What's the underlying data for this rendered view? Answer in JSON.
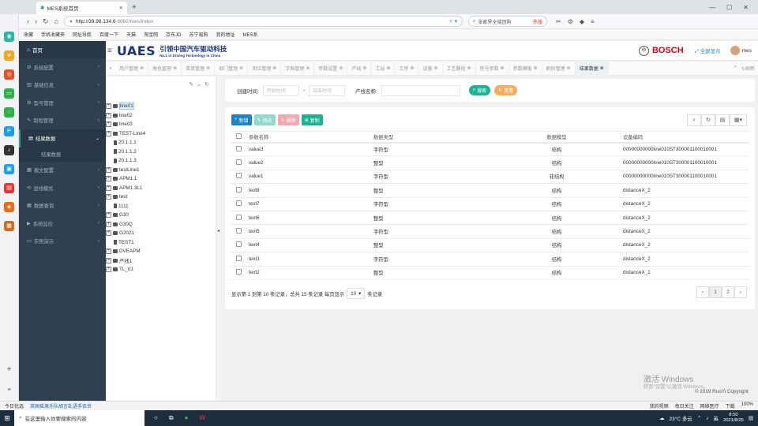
{
  "browser": {
    "tab_title": "MES系统首页",
    "url_host": "http://39.98.134.6",
    "url_path": ":8082/mes/index",
    "search_text": "张家界全域团购",
    "search_hot": "热搜",
    "favorites": [
      "收藏",
      "手机收藏夹",
      "网址导航",
      "百度一下",
      "天猫",
      "淘宝网",
      "京东JD",
      "苏宁易购",
      "我的地址",
      "MES系"
    ]
  },
  "sidebar": {
    "home": "首页",
    "items": [
      {
        "label": "系统配置"
      },
      {
        "label": "基础信息"
      },
      {
        "label": "型号管理"
      },
      {
        "label": "制程管理"
      },
      {
        "label": "结果数据"
      },
      {
        "label": "报文配置"
      },
      {
        "label": "混线模式"
      },
      {
        "label": "数据查询"
      },
      {
        "label": "系统监控"
      },
      {
        "label": "实例演示"
      }
    ],
    "sub_item": "结果数据"
  },
  "header": {
    "logo": "UAES",
    "company_cn": "引领中国汽车驱动科技",
    "company_en": "No.1 in Driving Technology in China",
    "bosch": "BOSCH",
    "fullscreen": "全屏显示",
    "user": "mes"
  },
  "page_tabs": [
    "用户管理",
    "角色管理",
    "菜单管理",
    "部门管理",
    "岗位管理",
    "字典管理",
    "参数设置",
    "产线",
    "工站",
    "工序",
    "设备",
    "工艺路径",
    "型号参数",
    "参数模板",
    "刷码管理",
    "结果数据"
  ],
  "refresh_label": "刷新",
  "tree": {
    "nodes": [
      {
        "label": "line01"
      },
      {
        "label": "line02"
      },
      {
        "label": "line03"
      },
      {
        "label": "TEST-Line4"
      },
      {
        "label": "20.1.1.1"
      },
      {
        "label": "20.1.1.2"
      },
      {
        "label": "20.1.1.3"
      },
      {
        "label": "testLine1"
      },
      {
        "label": "APM1.1"
      },
      {
        "label": "APM1.3L1"
      },
      {
        "label": "test"
      },
      {
        "label": "1111"
      },
      {
        "label": "G30"
      },
      {
        "label": "G30Q"
      },
      {
        "label": "G2021"
      },
      {
        "label": "TEST1"
      },
      {
        "label": "DVEAPM"
      },
      {
        "label": "产线1"
      },
      {
        "label": "TL_01"
      }
    ]
  },
  "search": {
    "time_label": "创建时间:",
    "start_placeholder": "开始时间",
    "end_placeholder": "结束时间",
    "line_label": "产线名称:",
    "search_btn": "搜索",
    "reset_btn": "重置"
  },
  "toolbar": {
    "add": "新增",
    "edit": "修改",
    "delete": "删除",
    "copy": "复制"
  },
  "table": {
    "headers": [
      "参数名称",
      "数据类型",
      "数据模型",
      "设备编码"
    ],
    "rows": [
      [
        "value3",
        "字符型",
        "结构",
        "00000000000line010ST300001100010001"
      ],
      [
        "value2",
        "整型",
        "结构",
        "00000000000line010ST300001100010001"
      ],
      [
        "value1",
        "字符型",
        "非结构",
        "00000000000line010ST300001100010001"
      ],
      [
        "text8",
        "整型",
        "结构",
        "distanceX_2"
      ],
      [
        "text7",
        "字符型",
        "结构",
        "distanceX_2"
      ],
      [
        "text6",
        "整型",
        "结构",
        "distanceX_2"
      ],
      [
        "text5",
        "字符型",
        "结构",
        "distanceX_2"
      ],
      [
        "text4",
        "整型",
        "结构",
        "distanceX_2"
      ],
      [
        "text3",
        "字符型",
        "结构",
        "distanceX_2"
      ],
      [
        "text2",
        "整型",
        "结构",
        "distanceX_1"
      ]
    ]
  },
  "pagination": {
    "info_prefix": "显示第 1 到第 10 条记录，总共 15 条记录  每页显示",
    "page_size": "10",
    "info_suffix": "条记录",
    "prev": "‹",
    "pages": [
      "1",
      "2"
    ],
    "next": "›"
  },
  "watermark": {
    "line1": "激活 Windows",
    "line2": "转到\"设置\"以激活 Windows。"
  },
  "copyright": "© 2019 RuoYi Copyright",
  "statusbar": {
    "left1": "今日优选",
    "left2": "英国摇滚乐队胡言乱语手去世",
    "right": [
      "我的视频",
      "每日关注",
      "网络医疗",
      "下载",
      "100%"
    ]
  },
  "taskbar": {
    "search": "在这里输入你要搜索的内容",
    "weather": "23°C 多云",
    "ime": "英",
    "time": "8:50",
    "date": "2021/8/25"
  },
  "colors": {
    "sidebar": "#2f4050",
    "primary": "#1c84c6",
    "success": "#1ab394",
    "orange": "#f8ac59",
    "danger": "#ed5565",
    "info": "#23c6c8"
  }
}
